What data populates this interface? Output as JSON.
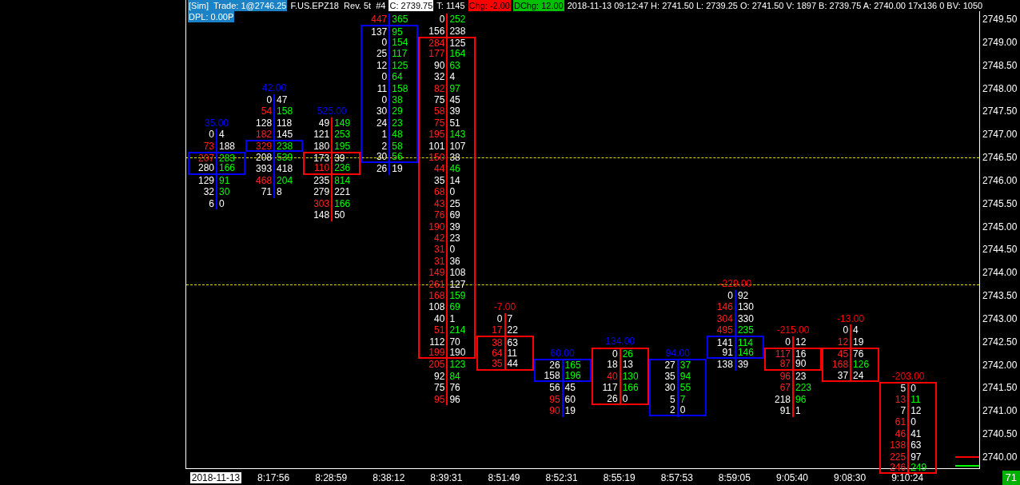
{
  "header": {
    "line_1": [
      {
        "text": "[Sim]  Trade: 1@2746.25",
        "kind": "sim"
      },
      {
        "text": "F.US.EPZ18  Rev. 5t  #4",
        "kind": "plain"
      },
      {
        "text": "C: 2739.75",
        "kind": "inverse"
      },
      {
        "text": "T: 1145",
        "kind": "plain"
      },
      {
        "text": "Chg: -2.00",
        "kind": "down"
      },
      {
        "text": "DChg: 12.00",
        "kind": "up"
      },
      {
        "text": "2018-11-13 09:12:47 H: 2741.50 L: 2739.25 O: 2741.50 V: 1897 B: 2739.75 A: 2740.00 17x136 0 BV: 1050",
        "kind": "plain"
      }
    ],
    "line_2": [
      {
        "text": "DPL: 0.00P",
        "kind": "sim"
      }
    ]
  },
  "price_axis": [
    "2749.50",
    "2749.00",
    "2748.50",
    "2748.00",
    "2747.50",
    "2747.00",
    "2746.50",
    "2746.00",
    "2745.50",
    "2745.00",
    "2744.50",
    "2744.00",
    "2743.50",
    "2743.00",
    "2742.50",
    "2742.00",
    "2741.50",
    "2741.00",
    "2740.50",
    "2740.00"
  ],
  "badge": "71",
  "bars": [
    {
      "time": "2018-11-13",
      "time_highlight": true,
      "delta": {
        "text": "35.00",
        "color": "#0000ff"
      },
      "color": "#0000ff",
      "rows": [
        {
          "kind": "gap"
        },
        {
          "kind": "gap"
        },
        {
          "kind": "gap"
        },
        {
          "kind": "gap"
        },
        {
          "kind": "gap"
        },
        {
          "kind": "gap"
        },
        {
          "kind": "gap"
        },
        {
          "kind": "gap"
        },
        {
          "kind": "gap"
        },
        {
          "kind": "gap"
        },
        {
          "kind": "volume",
          "bid": "0",
          "ask": "4",
          "bid_highlight": false,
          "ask_highlight": false,
          "in_box": false
        },
        {
          "kind": "volume",
          "bid": "73",
          "ask": "188",
          "bid_highlight": true,
          "ask_highlight": false,
          "in_box": false
        },
        {
          "kind": "volume",
          "bid": "207",
          "ask": "283",
          "bid_highlight": true,
          "ask_highlight": true,
          "in_box": true
        },
        {
          "kind": "volume",
          "bid": "280",
          "ask": "166",
          "bid_highlight": false,
          "ask_highlight": true,
          "in_box": true
        },
        {
          "kind": "volume",
          "bid": "129",
          "ask": "91",
          "bid_highlight": false,
          "ask_highlight": true,
          "in_box": false
        },
        {
          "kind": "volume",
          "bid": "32",
          "ask": "30",
          "bid_highlight": false,
          "ask_highlight": true,
          "in_box": false
        },
        {
          "kind": "volume",
          "bid": "6",
          "ask": "0",
          "bid_highlight": false,
          "ask_highlight": false,
          "in_box": false
        }
      ]
    },
    {
      "time": "8:17:56",
      "time_highlight": false,
      "delta": {
        "text": "42.00",
        "color": "#0000ff"
      },
      "color": "#0000ff",
      "rows": [
        {
          "kind": "gap"
        },
        {
          "kind": "gap"
        },
        {
          "kind": "gap"
        },
        {
          "kind": "gap"
        },
        {
          "kind": "gap"
        },
        {
          "kind": "gap"
        },
        {
          "kind": "gap"
        },
        {
          "kind": "volume",
          "bid": "0",
          "ask": "47",
          "bid_highlight": false,
          "ask_highlight": false,
          "in_box": false
        },
        {
          "kind": "volume",
          "bid": "54",
          "ask": "158",
          "bid_highlight": true,
          "ask_highlight": true,
          "in_box": false
        },
        {
          "kind": "volume",
          "bid": "128",
          "ask": "118",
          "bid_highlight": false,
          "ask_highlight": false,
          "in_box": false
        },
        {
          "kind": "volume",
          "bid": "182",
          "ask": "145",
          "bid_highlight": true,
          "ask_highlight": false,
          "in_box": false
        },
        {
          "kind": "volume",
          "bid": "329",
          "ask": "238",
          "bid_highlight": true,
          "ask_highlight": true,
          "in_box": true
        },
        {
          "kind": "volume",
          "bid": "208",
          "ask": "539",
          "bid_highlight": false,
          "ask_highlight": true,
          "in_box": false
        },
        {
          "kind": "volume",
          "bid": "393",
          "ask": "418",
          "bid_highlight": false,
          "ask_highlight": false,
          "in_box": false
        },
        {
          "kind": "volume",
          "bid": "468",
          "ask": "204",
          "bid_highlight": true,
          "ask_highlight": true,
          "in_box": false
        },
        {
          "kind": "volume",
          "bid": "71",
          "ask": "8",
          "bid_highlight": false,
          "ask_highlight": false,
          "in_box": false
        }
      ]
    },
    {
      "time": "8:28:59",
      "time_highlight": false,
      "delta": {
        "text": "525.00",
        "color": "#0000ff"
      },
      "color": "#ff0000",
      "rows": [
        {
          "kind": "gap"
        },
        {
          "kind": "gap"
        },
        {
          "kind": "gap"
        },
        {
          "kind": "gap"
        },
        {
          "kind": "gap"
        },
        {
          "kind": "gap"
        },
        {
          "kind": "gap"
        },
        {
          "kind": "gap"
        },
        {
          "kind": "gap"
        },
        {
          "kind": "volume",
          "bid": "49",
          "ask": "149",
          "bid_highlight": false,
          "ask_highlight": true,
          "in_box": false
        },
        {
          "kind": "volume",
          "bid": "121",
          "ask": "253",
          "bid_highlight": false,
          "ask_highlight": true,
          "in_box": false
        },
        {
          "kind": "volume",
          "bid": "180",
          "ask": "195",
          "bid_highlight": false,
          "ask_highlight": true,
          "in_box": false
        },
        {
          "kind": "volume",
          "bid": "173",
          "ask": "39",
          "bid_highlight": false,
          "ask_highlight": false,
          "in_box": true
        },
        {
          "kind": "volume",
          "bid": "110",
          "ask": "236",
          "bid_highlight": true,
          "ask_highlight": true,
          "in_box": true
        },
        {
          "kind": "volume",
          "bid": "235",
          "ask": "814",
          "bid_highlight": false,
          "ask_highlight": true,
          "in_box": false
        },
        {
          "kind": "volume",
          "bid": "279",
          "ask": "221",
          "bid_highlight": false,
          "ask_highlight": false,
          "in_box": false
        },
        {
          "kind": "volume",
          "bid": "303",
          "ask": "166",
          "bid_highlight": true,
          "ask_highlight": true,
          "in_box": false
        },
        {
          "kind": "volume",
          "bid": "148",
          "ask": "50",
          "bid_highlight": false,
          "ask_highlight": false,
          "in_box": false
        }
      ]
    },
    {
      "time": "8:38:12",
      "time_highlight": false,
      "color": "#0000ff",
      "rows": [
        {
          "kind": "gap"
        },
        {
          "kind": "volume",
          "bid": "447",
          "ask": "365",
          "bid_highlight": true,
          "ask_highlight": true,
          "in_box": false
        },
        {
          "kind": "volume",
          "bid": "137",
          "ask": "95",
          "bid_highlight": false,
          "ask_highlight": true,
          "in_box": true
        },
        {
          "kind": "volume",
          "bid": "0",
          "ask": "154",
          "bid_highlight": false,
          "ask_highlight": true,
          "in_box": true
        },
        {
          "kind": "volume",
          "bid": "25",
          "ask": "117",
          "bid_highlight": false,
          "ask_highlight": true,
          "in_box": true
        },
        {
          "kind": "volume",
          "bid": "12",
          "ask": "125",
          "bid_highlight": false,
          "ask_highlight": true,
          "in_box": true
        },
        {
          "kind": "volume",
          "bid": "0",
          "ask": "64",
          "bid_highlight": false,
          "ask_highlight": true,
          "in_box": true
        },
        {
          "kind": "volume",
          "bid": "11",
          "ask": "158",
          "bid_highlight": false,
          "ask_highlight": true,
          "in_box": true
        },
        {
          "kind": "volume",
          "bid": "0",
          "ask": "38",
          "bid_highlight": false,
          "ask_highlight": true,
          "in_box": true
        },
        {
          "kind": "volume",
          "bid": "30",
          "ask": "29",
          "bid_highlight": false,
          "ask_highlight": true,
          "in_box": true
        },
        {
          "kind": "volume",
          "bid": "24",
          "ask": "23",
          "bid_highlight": false,
          "ask_highlight": true,
          "in_box": true
        },
        {
          "kind": "volume",
          "bid": "1",
          "ask": "48",
          "bid_highlight": false,
          "ask_highlight": true,
          "in_box": true
        },
        {
          "kind": "volume",
          "bid": "2",
          "ask": "58",
          "bid_highlight": false,
          "ask_highlight": true,
          "in_box": true
        },
        {
          "kind": "volume",
          "bid": "30",
          "ask": "56",
          "bid_highlight": false,
          "ask_highlight": true,
          "in_box": true
        },
        {
          "kind": "volume",
          "bid": "26",
          "ask": "19",
          "bid_highlight": false,
          "ask_highlight": false,
          "in_box": false
        }
      ]
    },
    {
      "time": "8:39:31",
      "time_highlight": false,
      "color": "#ff0000",
      "rows": [
        {
          "kind": "gap"
        },
        {
          "kind": "volume",
          "bid": "0",
          "ask": "252",
          "bid_highlight": false,
          "ask_highlight": true,
          "in_box": false
        },
        {
          "kind": "volume",
          "bid": "156",
          "ask": "238",
          "bid_highlight": false,
          "ask_highlight": false,
          "in_box": false
        },
        {
          "kind": "volume",
          "bid": "284",
          "ask": "125",
          "bid_highlight": true,
          "ask_highlight": false,
          "in_box": true
        },
        {
          "kind": "volume",
          "bid": "177",
          "ask": "164",
          "bid_highlight": true,
          "ask_highlight": true,
          "in_box": true
        },
        {
          "kind": "volume",
          "bid": "90",
          "ask": "63",
          "bid_highlight": false,
          "ask_highlight": true,
          "in_box": true
        },
        {
          "kind": "volume",
          "bid": "32",
          "ask": "4",
          "bid_highlight": false,
          "ask_highlight": false,
          "in_box": true
        },
        {
          "kind": "volume",
          "bid": "82",
          "ask": "97",
          "bid_highlight": true,
          "ask_highlight": true,
          "in_box": true
        },
        {
          "kind": "volume",
          "bid": "75",
          "ask": "45",
          "bid_highlight": false,
          "ask_highlight": false,
          "in_box": true
        },
        {
          "kind": "volume",
          "bid": "58",
          "ask": "39",
          "bid_highlight": true,
          "ask_highlight": false,
          "in_box": true
        },
        {
          "kind": "volume",
          "bid": "75",
          "ask": "51",
          "bid_highlight": true,
          "ask_highlight": false,
          "in_box": true
        },
        {
          "kind": "volume",
          "bid": "195",
          "ask": "143",
          "bid_highlight": true,
          "ask_highlight": true,
          "in_box": true
        },
        {
          "kind": "volume",
          "bid": "101",
          "ask": "107",
          "bid_highlight": false,
          "ask_highlight": false,
          "in_box": true
        },
        {
          "kind": "volume",
          "bid": "150",
          "ask": "38",
          "bid_highlight": true,
          "ask_highlight": false,
          "in_box": true
        },
        {
          "kind": "volume",
          "bid": "44",
          "ask": "46",
          "bid_highlight": true,
          "ask_highlight": true,
          "in_box": true
        },
        {
          "kind": "volume",
          "bid": "35",
          "ask": "14",
          "bid_highlight": false,
          "ask_highlight": false,
          "in_box": true
        },
        {
          "kind": "volume",
          "bid": "68",
          "ask": "0",
          "bid_highlight": true,
          "ask_highlight": false,
          "in_box": true
        },
        {
          "kind": "volume",
          "bid": "43",
          "ask": "25",
          "bid_highlight": true,
          "ask_highlight": false,
          "in_box": true
        },
        {
          "kind": "volume",
          "bid": "76",
          "ask": "69",
          "bid_highlight": true,
          "ask_highlight": false,
          "in_box": true
        },
        {
          "kind": "volume",
          "bid": "190",
          "ask": "39",
          "bid_highlight": true,
          "ask_highlight": false,
          "in_box": true
        },
        {
          "kind": "volume",
          "bid": "42",
          "ask": "23",
          "bid_highlight": true,
          "ask_highlight": false,
          "in_box": true
        },
        {
          "kind": "volume",
          "bid": "31",
          "ask": "0",
          "bid_highlight": true,
          "ask_highlight": false,
          "in_box": true
        },
        {
          "kind": "volume",
          "bid": "31",
          "ask": "36",
          "bid_highlight": true,
          "ask_highlight": false,
          "in_box": true
        },
        {
          "kind": "volume",
          "bid": "149",
          "ask": "108",
          "bid_highlight": true,
          "ask_highlight": false,
          "in_box": true
        },
        {
          "kind": "volume",
          "bid": "261",
          "ask": "127",
          "bid_highlight": true,
          "ask_highlight": false,
          "in_box": true
        },
        {
          "kind": "volume",
          "bid": "168",
          "ask": "159",
          "bid_highlight": true,
          "ask_highlight": true,
          "in_box": true
        },
        {
          "kind": "volume",
          "bid": "108",
          "ask": "69",
          "bid_highlight": false,
          "ask_highlight": true,
          "in_box": true
        },
        {
          "kind": "volume",
          "bid": "40",
          "ask": "1",
          "bid_highlight": false,
          "ask_highlight": false,
          "in_box": true
        },
        {
          "kind": "volume",
          "bid": "51",
          "ask": "214",
          "bid_highlight": true,
          "ask_highlight": true,
          "in_box": true
        },
        {
          "kind": "volume",
          "bid": "112",
          "ask": "70",
          "bid_highlight": false,
          "ask_highlight": false,
          "in_box": true
        },
        {
          "kind": "volume",
          "bid": "199",
          "ask": "190",
          "bid_highlight": true,
          "ask_highlight": false,
          "in_box": true
        },
        {
          "kind": "volume",
          "bid": "205",
          "ask": "123",
          "bid_highlight": true,
          "ask_highlight": true,
          "in_box": false
        },
        {
          "kind": "volume",
          "bid": "92",
          "ask": "84",
          "bid_highlight": false,
          "ask_highlight": true,
          "in_box": false
        },
        {
          "kind": "volume",
          "bid": "75",
          "ask": "76",
          "bid_highlight": false,
          "ask_highlight": false,
          "in_box": false
        },
        {
          "kind": "volume",
          "bid": "95",
          "ask": "96",
          "bid_highlight": true,
          "ask_highlight": false,
          "in_box": false
        }
      ]
    },
    {
      "time": "8:51:49",
      "time_highlight": false,
      "delta": {
        "text": "-7.00",
        "color": "#ff0000"
      },
      "color": "#ff0000",
      "rows": [
        {
          "kind": "gap"
        },
        {
          "kind": "gap"
        },
        {
          "kind": "gap"
        },
        {
          "kind": "gap"
        },
        {
          "kind": "gap"
        },
        {
          "kind": "gap"
        },
        {
          "kind": "gap"
        },
        {
          "kind": "gap"
        },
        {
          "kind": "gap"
        },
        {
          "kind": "gap"
        },
        {
          "kind": "gap"
        },
        {
          "kind": "gap"
        },
        {
          "kind": "gap"
        },
        {
          "kind": "gap"
        },
        {
          "kind": "gap"
        },
        {
          "kind": "gap"
        },
        {
          "kind": "gap"
        },
        {
          "kind": "gap"
        },
        {
          "kind": "gap"
        },
        {
          "kind": "gap"
        },
        {
          "kind": "gap"
        },
        {
          "kind": "gap"
        },
        {
          "kind": "gap"
        },
        {
          "kind": "gap"
        },
        {
          "kind": "gap"
        },
        {
          "kind": "gap"
        },
        {
          "kind": "volume",
          "bid": "0",
          "ask": "7",
          "bid_highlight": false,
          "ask_highlight": false,
          "in_box": false
        },
        {
          "kind": "volume",
          "bid": "17",
          "ask": "22",
          "bid_highlight": true,
          "ask_highlight": false,
          "in_box": false
        },
        {
          "kind": "volume",
          "bid": "38",
          "ask": "63",
          "bid_highlight": true,
          "ask_highlight": false,
          "in_box": true
        },
        {
          "kind": "volume",
          "bid": "64",
          "ask": "11",
          "bid_highlight": true,
          "ask_highlight": false,
          "in_box": true
        },
        {
          "kind": "volume",
          "bid": "35",
          "ask": "44",
          "bid_highlight": true,
          "ask_highlight": false,
          "in_box": true
        }
      ]
    },
    {
      "time": "8:52:31",
      "time_highlight": false,
      "delta": {
        "text": "60.00",
        "color": "#0000ff"
      },
      "color": "#0000ff",
      "rows": [
        {
          "kind": "gap"
        },
        {
          "kind": "gap"
        },
        {
          "kind": "gap"
        },
        {
          "kind": "gap"
        },
        {
          "kind": "gap"
        },
        {
          "kind": "gap"
        },
        {
          "kind": "gap"
        },
        {
          "kind": "gap"
        },
        {
          "kind": "gap"
        },
        {
          "kind": "gap"
        },
        {
          "kind": "gap"
        },
        {
          "kind": "gap"
        },
        {
          "kind": "gap"
        },
        {
          "kind": "gap"
        },
        {
          "kind": "gap"
        },
        {
          "kind": "gap"
        },
        {
          "kind": "gap"
        },
        {
          "kind": "gap"
        },
        {
          "kind": "gap"
        },
        {
          "kind": "gap"
        },
        {
          "kind": "gap"
        },
        {
          "kind": "gap"
        },
        {
          "kind": "gap"
        },
        {
          "kind": "gap"
        },
        {
          "kind": "gap"
        },
        {
          "kind": "gap"
        },
        {
          "kind": "gap"
        },
        {
          "kind": "gap"
        },
        {
          "kind": "gap"
        },
        {
          "kind": "gap"
        },
        {
          "kind": "volume",
          "bid": "26",
          "ask": "165",
          "bid_highlight": false,
          "ask_highlight": true,
          "in_box": true
        },
        {
          "kind": "volume",
          "bid": "158",
          "ask": "196",
          "bid_highlight": false,
          "ask_highlight": true,
          "in_box": true
        },
        {
          "kind": "volume",
          "bid": "56",
          "ask": "45",
          "bid_highlight": false,
          "ask_highlight": false,
          "in_box": false
        },
        {
          "kind": "volume",
          "bid": "95",
          "ask": "60",
          "bid_highlight": true,
          "ask_highlight": false,
          "in_box": false
        },
        {
          "kind": "volume",
          "bid": "90",
          "ask": "19",
          "bid_highlight": true,
          "ask_highlight": false,
          "in_box": false
        }
      ]
    },
    {
      "time": "8:55:19",
      "time_highlight": false,
      "delta": {
        "text": "134.00",
        "color": "#0000ff"
      },
      "color": "#ff0000",
      "rows": [
        {
          "kind": "gap"
        },
        {
          "kind": "gap"
        },
        {
          "kind": "gap"
        },
        {
          "kind": "gap"
        },
        {
          "kind": "gap"
        },
        {
          "kind": "gap"
        },
        {
          "kind": "gap"
        },
        {
          "kind": "gap"
        },
        {
          "kind": "gap"
        },
        {
          "kind": "gap"
        },
        {
          "kind": "gap"
        },
        {
          "kind": "gap"
        },
        {
          "kind": "gap"
        },
        {
          "kind": "gap"
        },
        {
          "kind": "gap"
        },
        {
          "kind": "gap"
        },
        {
          "kind": "gap"
        },
        {
          "kind": "gap"
        },
        {
          "kind": "gap"
        },
        {
          "kind": "gap"
        },
        {
          "kind": "gap"
        },
        {
          "kind": "gap"
        },
        {
          "kind": "gap"
        },
        {
          "kind": "gap"
        },
        {
          "kind": "gap"
        },
        {
          "kind": "gap"
        },
        {
          "kind": "gap"
        },
        {
          "kind": "gap"
        },
        {
          "kind": "gap"
        },
        {
          "kind": "volume",
          "bid": "0",
          "ask": "26",
          "bid_highlight": false,
          "ask_highlight": true,
          "in_box": true
        },
        {
          "kind": "volume",
          "bid": "18",
          "ask": "13",
          "bid_highlight": false,
          "ask_highlight": false,
          "in_box": true
        },
        {
          "kind": "volume",
          "bid": "40",
          "ask": "130",
          "bid_highlight": true,
          "ask_highlight": true,
          "in_box": true
        },
        {
          "kind": "volume",
          "bid": "117",
          "ask": "166",
          "bid_highlight": false,
          "ask_highlight": true,
          "in_box": true
        },
        {
          "kind": "volume",
          "bid": "26",
          "ask": "0",
          "bid_highlight": false,
          "ask_highlight": false,
          "in_box": true
        }
      ]
    },
    {
      "time": "8:57:53",
      "time_highlight": false,
      "delta": {
        "text": "94.00",
        "color": "#0000ff"
      },
      "color": "#0000ff",
      "rows": [
        {
          "kind": "gap"
        },
        {
          "kind": "gap"
        },
        {
          "kind": "gap"
        },
        {
          "kind": "gap"
        },
        {
          "kind": "gap"
        },
        {
          "kind": "gap"
        },
        {
          "kind": "gap"
        },
        {
          "kind": "gap"
        },
        {
          "kind": "gap"
        },
        {
          "kind": "gap"
        },
        {
          "kind": "gap"
        },
        {
          "kind": "gap"
        },
        {
          "kind": "gap"
        },
        {
          "kind": "gap"
        },
        {
          "kind": "gap"
        },
        {
          "kind": "gap"
        },
        {
          "kind": "gap"
        },
        {
          "kind": "gap"
        },
        {
          "kind": "gap"
        },
        {
          "kind": "gap"
        },
        {
          "kind": "gap"
        },
        {
          "kind": "gap"
        },
        {
          "kind": "gap"
        },
        {
          "kind": "gap"
        },
        {
          "kind": "gap"
        },
        {
          "kind": "gap"
        },
        {
          "kind": "gap"
        },
        {
          "kind": "gap"
        },
        {
          "kind": "gap"
        },
        {
          "kind": "gap"
        },
        {
          "kind": "volume",
          "bid": "27",
          "ask": "37",
          "bid_highlight": false,
          "ask_highlight": true,
          "in_box": true
        },
        {
          "kind": "volume",
          "bid": "35",
          "ask": "94",
          "bid_highlight": false,
          "ask_highlight": true,
          "in_box": true
        },
        {
          "kind": "volume",
          "bid": "30",
          "ask": "55",
          "bid_highlight": false,
          "ask_highlight": true,
          "in_box": true
        },
        {
          "kind": "volume",
          "bid": "5",
          "ask": "7",
          "bid_highlight": false,
          "ask_highlight": true,
          "in_box": true
        },
        {
          "kind": "volume",
          "bid": "2",
          "ask": "0",
          "bid_highlight": false,
          "ask_highlight": false,
          "in_box": true
        }
      ]
    },
    {
      "time": "8:59:05",
      "time_highlight": false,
      "delta": {
        "text": "-229.00",
        "color": "#ff0000"
      },
      "color": "#0000ff",
      "rows": [
        {
          "kind": "gap"
        },
        {
          "kind": "gap"
        },
        {
          "kind": "gap"
        },
        {
          "kind": "gap"
        },
        {
          "kind": "gap"
        },
        {
          "kind": "gap"
        },
        {
          "kind": "gap"
        },
        {
          "kind": "gap"
        },
        {
          "kind": "gap"
        },
        {
          "kind": "gap"
        },
        {
          "kind": "gap"
        },
        {
          "kind": "gap"
        },
        {
          "kind": "gap"
        },
        {
          "kind": "gap"
        },
        {
          "kind": "gap"
        },
        {
          "kind": "gap"
        },
        {
          "kind": "gap"
        },
        {
          "kind": "gap"
        },
        {
          "kind": "gap"
        },
        {
          "kind": "gap"
        },
        {
          "kind": "gap"
        },
        {
          "kind": "gap"
        },
        {
          "kind": "gap"
        },
        {
          "kind": "gap"
        },
        {
          "kind": "volume",
          "bid": "0",
          "ask": "92",
          "bid_highlight": false,
          "ask_highlight": false,
          "in_box": false
        },
        {
          "kind": "volume",
          "bid": "146",
          "ask": "130",
          "bid_highlight": true,
          "ask_highlight": false,
          "in_box": false
        },
        {
          "kind": "volume",
          "bid": "304",
          "ask": "330",
          "bid_highlight": true,
          "ask_highlight": false,
          "in_box": false
        },
        {
          "kind": "volume",
          "bid": "495",
          "ask": "235",
          "bid_highlight": true,
          "ask_highlight": true,
          "in_box": false
        },
        {
          "kind": "volume",
          "bid": "141",
          "ask": "114",
          "bid_highlight": false,
          "ask_highlight": true,
          "in_box": true
        },
        {
          "kind": "volume",
          "bid": "91",
          "ask": "146",
          "bid_highlight": false,
          "ask_highlight": true,
          "in_box": true
        },
        {
          "kind": "volume",
          "bid": "138",
          "ask": "39",
          "bid_highlight": false,
          "ask_highlight": false,
          "in_box": false
        }
      ]
    },
    {
      "time": "9:05:40",
      "time_highlight": false,
      "delta": {
        "text": "-215.00",
        "color": "#ff0000"
      },
      "color": "#ff0000",
      "rows": [
        {
          "kind": "gap"
        },
        {
          "kind": "gap"
        },
        {
          "kind": "gap"
        },
        {
          "kind": "gap"
        },
        {
          "kind": "gap"
        },
        {
          "kind": "gap"
        },
        {
          "kind": "gap"
        },
        {
          "kind": "gap"
        },
        {
          "kind": "gap"
        },
        {
          "kind": "gap"
        },
        {
          "kind": "gap"
        },
        {
          "kind": "gap"
        },
        {
          "kind": "gap"
        },
        {
          "kind": "gap"
        },
        {
          "kind": "gap"
        },
        {
          "kind": "gap"
        },
        {
          "kind": "gap"
        },
        {
          "kind": "gap"
        },
        {
          "kind": "gap"
        },
        {
          "kind": "gap"
        },
        {
          "kind": "gap"
        },
        {
          "kind": "gap"
        },
        {
          "kind": "gap"
        },
        {
          "kind": "gap"
        },
        {
          "kind": "gap"
        },
        {
          "kind": "gap"
        },
        {
          "kind": "gap"
        },
        {
          "kind": "gap"
        },
        {
          "kind": "volume",
          "bid": "0",
          "ask": "12",
          "bid_highlight": false,
          "ask_highlight": false,
          "in_box": false
        },
        {
          "kind": "volume",
          "bid": "117",
          "ask": "16",
          "bid_highlight": true,
          "ask_highlight": false,
          "in_box": true
        },
        {
          "kind": "volume",
          "bid": "87",
          "ask": "90",
          "bid_highlight": true,
          "ask_highlight": false,
          "in_box": true
        },
        {
          "kind": "volume",
          "bid": "96",
          "ask": "23",
          "bid_highlight": true,
          "ask_highlight": false,
          "in_box": false
        },
        {
          "kind": "volume",
          "bid": "67",
          "ask": "223",
          "bid_highlight": true,
          "ask_highlight": true,
          "in_box": false
        },
        {
          "kind": "volume",
          "bid": "218",
          "ask": "96",
          "bid_highlight": false,
          "ask_highlight": true,
          "in_box": false
        },
        {
          "kind": "volume",
          "bid": "91",
          "ask": "1",
          "bid_highlight": false,
          "ask_highlight": false,
          "in_box": false
        }
      ]
    },
    {
      "time": "9:08:30",
      "time_highlight": false,
      "delta": {
        "text": "-13.00",
        "color": "#ff0000"
      },
      "color": "#ff0000",
      "rows": [
        {
          "kind": "gap"
        },
        {
          "kind": "gap"
        },
        {
          "kind": "gap"
        },
        {
          "kind": "gap"
        },
        {
          "kind": "gap"
        },
        {
          "kind": "gap"
        },
        {
          "kind": "gap"
        },
        {
          "kind": "gap"
        },
        {
          "kind": "gap"
        },
        {
          "kind": "gap"
        },
        {
          "kind": "gap"
        },
        {
          "kind": "gap"
        },
        {
          "kind": "gap"
        },
        {
          "kind": "gap"
        },
        {
          "kind": "gap"
        },
        {
          "kind": "gap"
        },
        {
          "kind": "gap"
        },
        {
          "kind": "gap"
        },
        {
          "kind": "gap"
        },
        {
          "kind": "gap"
        },
        {
          "kind": "gap"
        },
        {
          "kind": "gap"
        },
        {
          "kind": "gap"
        },
        {
          "kind": "gap"
        },
        {
          "kind": "gap"
        },
        {
          "kind": "gap"
        },
        {
          "kind": "gap"
        },
        {
          "kind": "volume",
          "bid": "0",
          "ask": "4",
          "bid_highlight": false,
          "ask_highlight": false,
          "in_box": false
        },
        {
          "kind": "volume",
          "bid": "12",
          "ask": "19",
          "bid_highlight": true,
          "ask_highlight": false,
          "in_box": false
        },
        {
          "kind": "volume",
          "bid": "45",
          "ask": "76",
          "bid_highlight": true,
          "ask_highlight": false,
          "in_box": true
        },
        {
          "kind": "volume",
          "bid": "168",
          "ask": "126",
          "bid_highlight": true,
          "ask_highlight": true,
          "in_box": true
        },
        {
          "kind": "volume",
          "bid": "37",
          "ask": "24",
          "bid_highlight": false,
          "ask_highlight": false,
          "in_box": true
        }
      ]
    },
    {
      "time": "9:10:24",
      "time_highlight": false,
      "delta": {
        "text": "-203.00",
        "color": "#ff0000"
      },
      "color": "#ff0000",
      "rows": [
        {
          "kind": "gap"
        },
        {
          "kind": "gap"
        },
        {
          "kind": "gap"
        },
        {
          "kind": "gap"
        },
        {
          "kind": "gap"
        },
        {
          "kind": "gap"
        },
        {
          "kind": "gap"
        },
        {
          "kind": "gap"
        },
        {
          "kind": "gap"
        },
        {
          "kind": "gap"
        },
        {
          "kind": "gap"
        },
        {
          "kind": "gap"
        },
        {
          "kind": "gap"
        },
        {
          "kind": "gap"
        },
        {
          "kind": "gap"
        },
        {
          "kind": "gap"
        },
        {
          "kind": "gap"
        },
        {
          "kind": "gap"
        },
        {
          "kind": "gap"
        },
        {
          "kind": "gap"
        },
        {
          "kind": "gap"
        },
        {
          "kind": "gap"
        },
        {
          "kind": "gap"
        },
        {
          "kind": "gap"
        },
        {
          "kind": "gap"
        },
        {
          "kind": "gap"
        },
        {
          "kind": "gap"
        },
        {
          "kind": "gap"
        },
        {
          "kind": "gap"
        },
        {
          "kind": "gap"
        },
        {
          "kind": "gap"
        },
        {
          "kind": "gap"
        },
        {
          "kind": "volume",
          "bid": "5",
          "ask": "0",
          "bid_highlight": false,
          "ask_highlight": false,
          "in_box": true
        },
        {
          "kind": "volume",
          "bid": "13",
          "ask": "11",
          "bid_highlight": true,
          "ask_highlight": true,
          "in_box": true
        },
        {
          "kind": "volume",
          "bid": "7",
          "ask": "12",
          "bid_highlight": false,
          "ask_highlight": false,
          "in_box": true
        },
        {
          "kind": "volume",
          "bid": "61",
          "ask": "0",
          "bid_highlight": true,
          "ask_highlight": false,
          "in_box": true
        },
        {
          "kind": "volume",
          "bid": "46",
          "ask": "41",
          "bid_highlight": true,
          "ask_highlight": false,
          "in_box": true
        },
        {
          "kind": "volume",
          "bid": "138",
          "ask": "63",
          "bid_highlight": true,
          "ask_highlight": false,
          "in_box": true
        },
        {
          "kind": "volume",
          "bid": "225",
          "ask": "97",
          "bid_highlight": true,
          "ask_highlight": false,
          "in_box": true
        },
        {
          "kind": "volume",
          "bid": "246",
          "ask": "249",
          "bid_highlight": true,
          "ask_highlight": true,
          "in_box": true
        }
      ]
    }
  ]
}
